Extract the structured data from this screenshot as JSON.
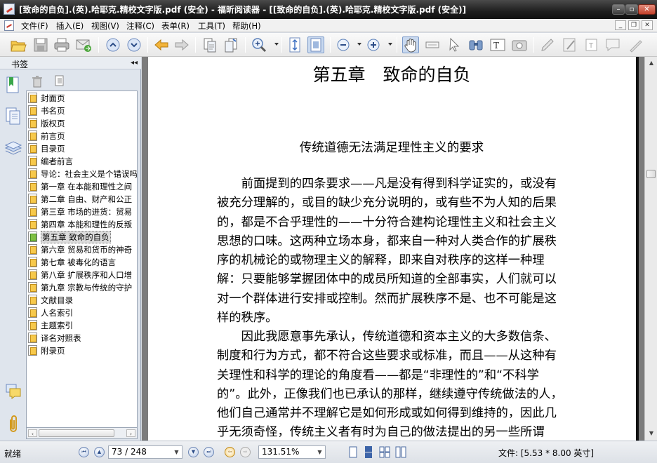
{
  "window": {
    "title": "[致命的自负].(英).哈耶克.精校文字版.pdf (安全) - 福昕阅读器 - [[致命的自负].(英).哈耶克.精校文字版.pdf (安全)]",
    "minimize_glyph": "–",
    "maximize_glyph": "▫",
    "close_glyph": "✕"
  },
  "menubar": {
    "items": [
      "文件(F)",
      "插入(E)",
      "视图(V)",
      "注释(C)",
      "表单(R)",
      "工具(T)",
      "帮助(H)"
    ],
    "mdi_minimize": "_",
    "mdi_restore": "❐",
    "mdi_close": "✕"
  },
  "toolbar": {
    "icons": [
      "open-icon",
      "save-icon",
      "print-icon",
      "email-icon",
      "prev-page-icon",
      "next-page-icon",
      "back-icon",
      "forward-icon",
      "extract-pages-icon",
      "insert-pages-icon",
      "zoom-in-icon",
      "fit-page-icon",
      "actual-size-icon",
      "zoom-out-icon",
      "zoom-plus-icon",
      "hand-tool-icon",
      "select-text-icon",
      "select-icon",
      "find-icon",
      "typewriter-icon",
      "snapshot-icon",
      "highlight-icon",
      "note-icon",
      "textbox-icon",
      "comment-icon",
      "pencil-icon"
    ]
  },
  "sidebar": {
    "header_label": "书签",
    "collapse_glyph": "◂◂",
    "tabs": [
      "bookmarks-tab-icon",
      "pages-tab-icon",
      "layers-tab-icon",
      "comments-tab-icon",
      "attachments-tab-icon"
    ],
    "bookmarks": [
      {
        "label": "封面页"
      },
      {
        "label": "书名页"
      },
      {
        "label": "版权页"
      },
      {
        "label": "前言页"
      },
      {
        "label": "目录页"
      },
      {
        "label": "编者前言"
      },
      {
        "label": "导论：社会主义是个错误吗"
      },
      {
        "label": "第一章 在本能和理性之间"
      },
      {
        "label": "第二章 自由、财产和公正"
      },
      {
        "label": "第三章 市场的进货：贸易"
      },
      {
        "label": "第四章 本能和理性的反叛"
      },
      {
        "label": "第五章 致命的自负"
      },
      {
        "label": "第六章 贸易和货币的神奇"
      },
      {
        "label": "第七章 被毒化的语言"
      },
      {
        "label": "第八章 扩展秩序和人口增"
      },
      {
        "label": "第九章 宗教与传统的守护"
      },
      {
        "label": "文献目录"
      },
      {
        "label": "人名索引"
      },
      {
        "label": "主题索引"
      },
      {
        "label": "译名对照表"
      },
      {
        "label": "附录页"
      }
    ],
    "selected_index": 11,
    "scroll_left_glyph": "‹",
    "scroll_right_glyph": "›"
  },
  "document": {
    "chapter_title": "第五章　致命的自负",
    "section_title": "传统道德无法满足理性主义的要求",
    "paragraph1": [
      "　　前面提到的四条要求——凡是没有得到科学证实的，或没有",
      "被充分理解的，或目的缺少充分说明的，或有些不为人知的后果",
      "的，都是不合乎理性的——十分符合建构论理性主义和社会主义",
      "思想的口味。这两种立场本身，都来自一种对人类合作的扩展秩",
      "序的机械论的或物理主义的解释，即来自对秩序的这样一种理",
      "解：只要能够掌握团体中的成员所知道的全部事实，人们就可以",
      "对一个群体进行安排或控制。然而扩展秩序不是、也不可能是这",
      "样的秩序。"
    ],
    "paragraph2": [
      "　　因此我愿意事先承认，传统道德和资本主义的大多数信条、",
      "制度和行为方式，都不符合这些要求或标准，而且——从这种有",
      "关理性和科学的理论的角度看——都是“非理性的”和“不科学",
      "的”。此外，正像我们也已承认的那样，继续遵守传统做法的人，",
      "他们自己通常并不理解它是如何形成或如何得到维持的，因此几",
      "乎无须奇怪，传统主义者有时为自己的做法提出的另一些所谓"
    ]
  },
  "vscroll": {
    "up_glyph": "▲",
    "down_glyph": "▼"
  },
  "statusbar": {
    "ready_label": "就绪",
    "first_glyph": "⏮",
    "prev_glyph": "▲",
    "page_value": "73 / 248",
    "next_glyph": "▼",
    "last_glyph": "⏭",
    "back_glyph": "⇦",
    "forward_glyph": "⇨",
    "zoom_value": "131.51%",
    "drop_glyph": "▼",
    "file_info": "文件: [5.53 * 8.00 英寸]"
  },
  "colors": {
    "titlebar": "#1e1e1e",
    "selection_bg": "#dcdcdc",
    "viewer_bg": "#7c7c7c"
  }
}
